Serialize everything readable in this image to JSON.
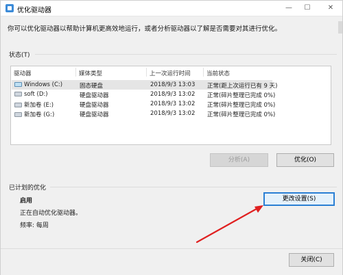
{
  "window": {
    "title": "优化驱动器",
    "minimize": "—",
    "maximize": "☐",
    "close": "✕"
  },
  "description": "你可以优化驱动器以帮助计算机更高效地运行，或者分析驱动器以了解是否需要对其进行优化。",
  "status_group": {
    "label": "状态(T)",
    "columns": [
      "驱动器",
      "媒体类型",
      "上一次运行时间",
      "当前状态"
    ],
    "rows": [
      {
        "drive": "Windows (C:)",
        "media": "固态硬盘",
        "last_run": "2018/9/3 13:03",
        "status": "正常(距上次运行已有 9 天)",
        "icon": "system-drive-icon"
      },
      {
        "drive": "soft (D:)",
        "media": "硬盘驱动器",
        "last_run": "2018/9/3 13:02",
        "status": "正常(碎片整理已完成 0%)",
        "icon": "hard-drive-icon"
      },
      {
        "drive": "新加卷 (E:)",
        "media": "硬盘驱动器",
        "last_run": "2018/9/3 13:02",
        "status": "正常(碎片整理已完成 0%)",
        "icon": "hard-drive-icon"
      },
      {
        "drive": "新加卷 (G:)",
        "media": "硬盘驱动器",
        "last_run": "2018/9/3 13:02",
        "status": "正常(碎片整理已完成 0%)",
        "icon": "hard-drive-icon"
      }
    ],
    "analyze_button": "分析(A)",
    "optimize_button": "优化(O)"
  },
  "schedule_group": {
    "label": "已计划的优化",
    "state": "启用",
    "auto_text": "正在自动优化驱动器。",
    "frequency": "频率: 每周",
    "change_settings_button": "更改设置(S)"
  },
  "footer": {
    "close_button": "关闭(C)"
  },
  "colors": {
    "accent": "#2a7fd4",
    "arrow": "#e02020",
    "selected_row": "#e5e5e5"
  }
}
